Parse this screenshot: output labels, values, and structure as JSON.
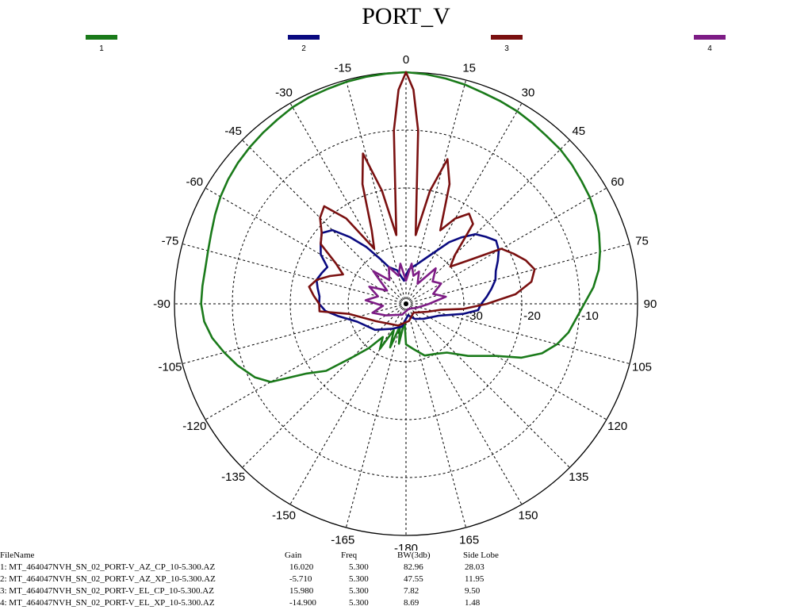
{
  "chart_data": {
    "type": "polar",
    "title": "PORT_V",
    "angle_ticks": [
      "0",
      "15",
      "30",
      "45",
      "60",
      "75",
      "90",
      "105",
      "120",
      "135",
      "150",
      "165",
      "-180",
      "-165",
      "-150",
      "-135",
      "-120",
      "-105",
      "-90",
      "-75",
      "-60",
      "-45",
      "-30",
      "-15"
    ],
    "angle_tick_values": [
      0,
      15,
      30,
      45,
      60,
      75,
      90,
      105,
      120,
      135,
      150,
      165,
      180,
      195,
      210,
      225,
      240,
      255,
      270,
      285,
      300,
      315,
      330,
      345
    ],
    "radial_axis": {
      "min_db": -40,
      "max_db": 0,
      "grid_db": [
        -30,
        -20,
        -10,
        0
      ],
      "tick_labels": [
        "-30",
        "-20",
        "-10"
      ]
    },
    "grid": true,
    "legend_placement": "top",
    "series": [
      {
        "name": "1",
        "color": "#1a7a1a",
        "points": [
          [
            -120,
            -13
          ],
          [
            -116,
            -11
          ],
          [
            -110,
            -9
          ],
          [
            -105,
            -7.5
          ],
          [
            -100,
            -6
          ],
          [
            -95,
            -5
          ],
          [
            -90,
            -4.6
          ],
          [
            -85,
            -4.7
          ],
          [
            -80,
            -4.8
          ],
          [
            -75,
            -4.6
          ],
          [
            -70,
            -4.2
          ],
          [
            -65,
            -3.6
          ],
          [
            -60,
            -3.0
          ],
          [
            -55,
            -2.5
          ],
          [
            -50,
            -2.1
          ],
          [
            -45,
            -1.8
          ],
          [
            -40,
            -1.5
          ],
          [
            -35,
            -1.2
          ],
          [
            -30,
            -0.8
          ],
          [
            -25,
            -0.6
          ],
          [
            -20,
            -0.5
          ],
          [
            -15,
            -0.3
          ],
          [
            -10,
            -0.2
          ],
          [
            -5,
            -0.1
          ],
          [
            0,
            0
          ],
          [
            5,
            -0.2
          ],
          [
            10,
            -0.5
          ],
          [
            15,
            -0.8
          ],
          [
            20,
            -1.2
          ],
          [
            25,
            -1.4
          ],
          [
            30,
            -1.6
          ],
          [
            35,
            -1.9
          ],
          [
            40,
            -2.2
          ],
          [
            45,
            -2.3
          ],
          [
            50,
            -2.6
          ],
          [
            55,
            -3.0
          ],
          [
            60,
            -3.3
          ],
          [
            65,
            -3.8
          ],
          [
            70,
            -4.5
          ],
          [
            75,
            -5.3
          ],
          [
            80,
            -6.2
          ],
          [
            85,
            -7.5
          ],
          [
            90,
            -9.2
          ],
          [
            95,
            -10.5
          ],
          [
            100,
            -11.5
          ],
          [
            105,
            -13
          ],
          [
            110,
            -15
          ],
          [
            115,
            -18
          ],
          [
            120,
            -22
          ],
          [
            130,
            -26
          ],
          [
            140,
            -29
          ],
          [
            150,
            -30
          ],
          [
            160,
            -30.5
          ],
          [
            170,
            -32
          ],
          [
            180,
            -33
          ],
          [
            185,
            -37
          ],
          [
            190,
            -33
          ],
          [
            195,
            -36
          ],
          [
            200,
            -32
          ],
          [
            205,
            -35
          ],
          [
            210,
            -31
          ],
          [
            215,
            -33
          ],
          [
            220,
            -30
          ],
          [
            225,
            -27
          ],
          [
            230,
            -22
          ],
          [
            235,
            -19
          ]
        ]
      },
      {
        "name": "2",
        "color": "#0a0a80",
        "points": [
          [
            -110,
            -31
          ],
          [
            -100,
            -28
          ],
          [
            -95,
            -26
          ],
          [
            -90,
            -25
          ],
          [
            -85,
            -25
          ],
          [
            -80,
            -24.5
          ],
          [
            -75,
            -24
          ],
          [
            -70,
            -24.5
          ],
          [
            -65,
            -25
          ],
          [
            -60,
            -23
          ],
          [
            -55,
            -22
          ],
          [
            -50,
            -21
          ],
          [
            -45,
            -22
          ],
          [
            -40,
            -25
          ],
          [
            -35,
            -28
          ],
          [
            -30,
            -31
          ],
          [
            -25,
            -33
          ],
          [
            -15,
            -34
          ],
          [
            -5,
            -36
          ],
          [
            0,
            -35
          ],
          [
            5,
            -34
          ],
          [
            15,
            -33
          ],
          [
            25,
            -31
          ],
          [
            35,
            -27
          ],
          [
            40,
            -25
          ],
          [
            45,
            -23
          ],
          [
            50,
            -22
          ],
          [
            55,
            -21
          ],
          [
            60,
            -21.5
          ],
          [
            65,
            -22.5
          ],
          [
            70,
            -23.5
          ],
          [
            75,
            -24
          ],
          [
            80,
            -25
          ],
          [
            85,
            -26
          ],
          [
            90,
            -27
          ],
          [
            95,
            -27.5
          ],
          [
            100,
            -30
          ],
          [
            110,
            -34
          ],
          [
            130,
            -36
          ],
          [
            150,
            -37
          ],
          [
            170,
            -38
          ],
          [
            190,
            -36
          ],
          [
            210,
            -35
          ],
          [
            230,
            -33
          ],
          [
            250,
            -31
          ]
        ]
      },
      {
        "name": "3",
        "color": "#7a1010",
        "points": [
          [
            -95,
            -25
          ],
          [
            -90,
            -25
          ],
          [
            -85,
            -24
          ],
          [
            -80,
            -23
          ],
          [
            -75,
            -24
          ],
          [
            -70,
            -26
          ],
          [
            -65,
            -28
          ],
          [
            -60,
            -26
          ],
          [
            -55,
            -22
          ],
          [
            -50,
            -21
          ],
          [
            -45,
            -19
          ],
          [
            -40,
            -18
          ],
          [
            -35,
            -22
          ],
          [
            -30,
            -29
          ],
          [
            -25,
            -26
          ],
          [
            -20,
            -18
          ],
          [
            -16,
            -13
          ],
          [
            -12,
            -20
          ],
          [
            -8,
            -28
          ],
          [
            -4,
            -10
          ],
          [
            -2,
            -3
          ],
          [
            0,
            0
          ],
          [
            2,
            -3
          ],
          [
            4,
            -10
          ],
          [
            8,
            -28
          ],
          [
            12,
            -20
          ],
          [
            16,
            -14
          ],
          [
            20,
            -18
          ],
          [
            25,
            -26
          ],
          [
            30,
            -23
          ],
          [
            35,
            -21
          ],
          [
            40,
            -22
          ],
          [
            45,
            -28
          ],
          [
            50,
            -30
          ],
          [
            55,
            -27
          ],
          [
            60,
            -21
          ],
          [
            65,
            -19.5
          ],
          [
            70,
            -18
          ],
          [
            75,
            -17
          ],
          [
            80,
            -18
          ],
          [
            85,
            -21
          ],
          [
            90,
            -26
          ],
          [
            95,
            -30
          ],
          [
            100,
            -34
          ],
          [
            110,
            -36
          ],
          [
            140,
            -38
          ],
          [
            170,
            -37
          ],
          [
            200,
            -36
          ],
          [
            240,
            -34
          ],
          [
            260,
            -30
          ]
        ]
      },
      {
        "name": "4",
        "color": "#7d1c85",
        "points": [
          [
            0,
            -36
          ],
          [
            8,
            -33
          ],
          [
            15,
            -35
          ],
          [
            22,
            -34
          ],
          [
            30,
            -36
          ],
          [
            40,
            -32
          ],
          [
            50,
            -34
          ],
          [
            60,
            -33
          ],
          [
            70,
            -35
          ],
          [
            80,
            -33
          ],
          [
            90,
            -36
          ],
          [
            110,
            -38
          ],
          [
            150,
            -39
          ],
          [
            200,
            -38
          ],
          [
            240,
            -36
          ],
          [
            255,
            -34
          ],
          [
            265,
            -36
          ],
          [
            275,
            -33
          ],
          [
            285,
            -35
          ],
          [
            295,
            -33
          ],
          [
            305,
            -36
          ],
          [
            315,
            -32
          ],
          [
            325,
            -35
          ],
          [
            335,
            -33
          ],
          [
            345,
            -35
          ],
          [
            352,
            -33
          ]
        ]
      }
    ]
  },
  "info_table": {
    "headers": {
      "file": "FileName",
      "gain": "Gain",
      "freq": "Freq",
      "bw": "BW(3db)",
      "sidelobe": "Side Lobe"
    },
    "rows": [
      {
        "file": "1: MT_464047NVH_SN_02_PORT-V_AZ_CP_10-5.300.AZ",
        "gain": "16.020",
        "freq": "5.300",
        "bw": "82.96",
        "sidelobe": "28.03"
      },
      {
        "file": "2: MT_464047NVH_SN_02_PORT-V_AZ_XP_10-5.300.AZ",
        "gain": "-5.710",
        "freq": "5.300",
        "bw": "47.55",
        "sidelobe": "11.95"
      },
      {
        "file": "3: MT_464047NVH_SN_02_PORT-V_EL_CP_10-5.300.AZ",
        "gain": "15.980",
        "freq": "5.300",
        "bw": "7.82",
        "sidelobe": "9.50"
      },
      {
        "file": "4: MT_464047NVH_SN_02_PORT-V_EL_XP_10-5.300.AZ",
        "gain": "-14.900",
        "freq": "5.300",
        "bw": "8.69",
        "sidelobe": "1.48"
      }
    ]
  }
}
